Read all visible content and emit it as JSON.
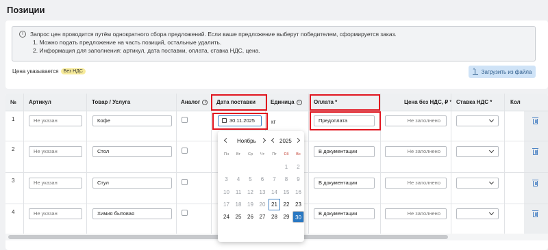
{
  "page_title": "Позиции",
  "notice": {
    "text": "Запрос цен проводится путём однократного сбора предложений. Если ваше предложение выберут победителем, сформируется заказ.",
    "items": [
      "1. Можно подать предложение на часть позиций, остальные удалить.",
      "2. Информация для заполнения: артикул, дата поставки, оплата, ставка НДС, цена."
    ]
  },
  "price_note": {
    "label": "Цена указывается",
    "badge": "Без НДС"
  },
  "upload_button": "Загрузить из файла",
  "columns": {
    "num": "№",
    "article": "Артикул",
    "product": "Товар / Услуга",
    "analog": "Аналог",
    "delivery_date": "Дата поставки",
    "unit": "Единица",
    "payment": "Оплата *",
    "price": "Цена без НДС, ₽ *",
    "vat": "Ставка НДС *",
    "qty": "Кол"
  },
  "rows": [
    {
      "num": "1",
      "article_placeholder": "Не указан",
      "product": "Кофе",
      "date": "30.11.2025",
      "unit": "кг",
      "payment": "Предоплата",
      "price_placeholder": "Не заполнено"
    },
    {
      "num": "2",
      "article_placeholder": "Не указан",
      "product": "Стол",
      "payment": "В документации",
      "price_placeholder": "Не заполнено"
    },
    {
      "num": "3",
      "article_placeholder": "Не указан",
      "product": "Стул",
      "payment": "В документации",
      "price_placeholder": "Не заполнено"
    },
    {
      "num": "4",
      "article_placeholder": "Не указан",
      "product": "Химия бытовая",
      "payment": "В документации",
      "price_placeholder": "Не заполнено"
    }
  ],
  "calendar": {
    "month": "Ноябрь",
    "year": "2025",
    "weekdays": [
      "Пн",
      "Вт",
      "Ср",
      "Чт",
      "Пт",
      "Сб",
      "Вс"
    ],
    "weeks": [
      [
        "",
        "",
        "",
        "",
        "",
        "1",
        "2"
      ],
      [
        "3",
        "4",
        "5",
        "6",
        "7",
        "8",
        "9"
      ],
      [
        "10",
        "11",
        "12",
        "13",
        "14",
        "15",
        "16"
      ],
      [
        "17",
        "18",
        "19",
        "20",
        "21",
        "22",
        "23"
      ],
      [
        "24",
        "25",
        "26",
        "27",
        "28",
        "29",
        "30"
      ]
    ],
    "today": "21",
    "selected": "30"
  },
  "colors": {
    "accent": "#2a78c2",
    "highlight": "#e1141e",
    "badge": "#f7eb9a"
  }
}
